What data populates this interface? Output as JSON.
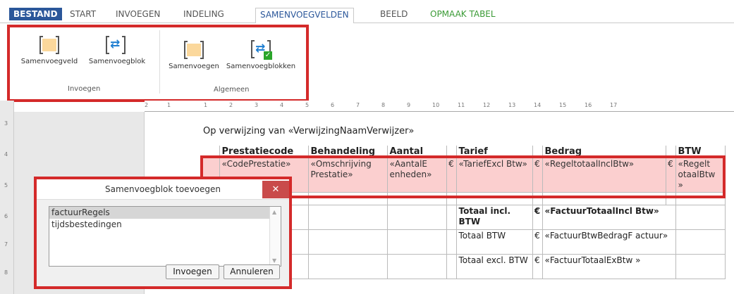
{
  "tabs": [
    "BESTAND",
    "START",
    "INVOEGEN",
    "INDELING",
    "SAMENVOEGVELDEN",
    "BEELD",
    "OPMAAK TABEL"
  ],
  "ribbon": {
    "groups": [
      {
        "label": "Invoegen",
        "buttons": [
          "Samenvoegveld",
          "Samenvoegblok"
        ]
      },
      {
        "label": "Algemeen",
        "buttons": [
          "Samenvoegen",
          "Samenvoegblokken"
        ]
      }
    ]
  },
  "ruler": {
    "ticks": [
      "2",
      "1",
      "1",
      "2",
      "3",
      "4",
      "5",
      "6",
      "7",
      "8",
      "9",
      "10",
      "11",
      "12",
      "13",
      "14",
      "15",
      "16",
      "17"
    ],
    "vticks": [
      "3",
      "4",
      "5",
      "6",
      "7",
      "8"
    ]
  },
  "document": {
    "reference": "Op verwijzing van «VerwijzingNaamVerwijzer»",
    "table": {
      "headers": [
        "Prestatiecode",
        "Behandeling",
        "Aantal",
        "",
        "Tarief",
        "",
        "Bedrag",
        "",
        "BTW"
      ],
      "merge_row": [
        "«CodePrestatie»",
        "«Omschrijving Prestatie»",
        "«AantalE enheden»",
        "€",
        "«TariefExcl Btw»",
        "€",
        "«RegeltotaalInclBtw»",
        "€",
        "«Regelt otaalBtw »"
      ],
      "totals": [
        {
          "label": "Totaal incl. BTW",
          "euro": "€",
          "value": "«FactuurTotaalIncl Btw»",
          "bold": true
        },
        {
          "label": "Totaal BTW",
          "euro": "€",
          "value": "«FactuurBtwBedragF actuur»",
          "bold": false
        },
        {
          "label": "Totaal excl. BTW",
          "euro": "€",
          "value": "«FactuurTotaalExBtw »",
          "bold": false
        }
      ]
    }
  },
  "dialog": {
    "title": "Samenvoegblok toevoegen",
    "items": [
      "factuurRegels",
      "tijdsbestedingen"
    ],
    "selected": "factuurRegels",
    "ok_label": "Invoegen",
    "cancel_label": "Annuleren"
  },
  "colors": {
    "accent": "#2b579a",
    "highlight": "#d42a2a",
    "merge_fill": "#fbcfcf",
    "tab_green": "#3a9a35"
  }
}
